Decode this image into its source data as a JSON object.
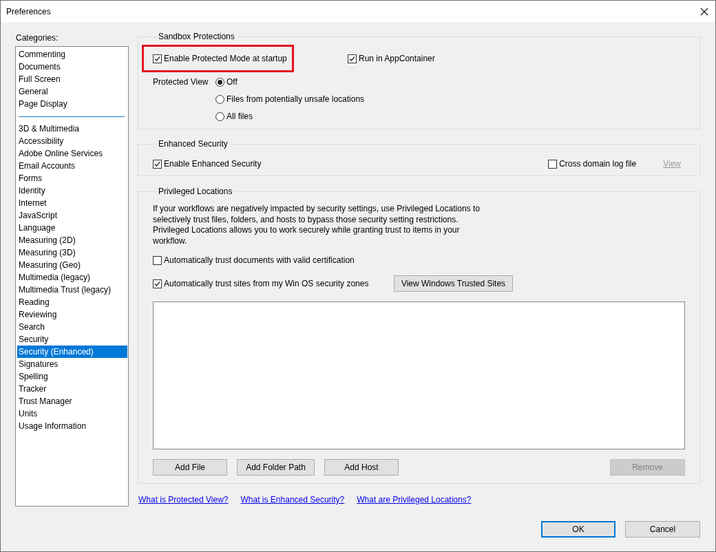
{
  "window": {
    "title": "Preferences"
  },
  "sidebar": {
    "label": "Categories:",
    "groups": [
      [
        {
          "label": "Commenting",
          "selected": false
        },
        {
          "label": "Documents",
          "selected": false
        },
        {
          "label": "Full Screen",
          "selected": false
        },
        {
          "label": "General",
          "selected": false
        },
        {
          "label": "Page Display",
          "selected": false
        }
      ],
      [
        {
          "label": "3D & Multimedia",
          "selected": false
        },
        {
          "label": "Accessibility",
          "selected": false
        },
        {
          "label": "Adobe Online Services",
          "selected": false
        },
        {
          "label": "Email Accounts",
          "selected": false
        },
        {
          "label": "Forms",
          "selected": false
        },
        {
          "label": "Identity",
          "selected": false
        },
        {
          "label": "Internet",
          "selected": false
        },
        {
          "label": "JavaScript",
          "selected": false
        },
        {
          "label": "Language",
          "selected": false
        },
        {
          "label": "Measuring (2D)",
          "selected": false
        },
        {
          "label": "Measuring (3D)",
          "selected": false
        },
        {
          "label": "Measuring (Geo)",
          "selected": false
        },
        {
          "label": "Multimedia (legacy)",
          "selected": false
        },
        {
          "label": "Multimedia Trust (legacy)",
          "selected": false
        },
        {
          "label": "Reading",
          "selected": false
        },
        {
          "label": "Reviewing",
          "selected": false
        },
        {
          "label": "Search",
          "selected": false
        },
        {
          "label": "Security",
          "selected": false
        },
        {
          "label": "Security (Enhanced)",
          "selected": true
        },
        {
          "label": "Signatures",
          "selected": false
        },
        {
          "label": "Spelling",
          "selected": false
        },
        {
          "label": "Tracker",
          "selected": false
        },
        {
          "label": "Trust Manager",
          "selected": false
        },
        {
          "label": "Units",
          "selected": false
        },
        {
          "label": "Usage Information",
          "selected": false
        }
      ]
    ]
  },
  "sandbox": {
    "title": "Sandbox Protections",
    "checkboxes": [
      {
        "label": "Enable Protected Mode at startup",
        "checked": true,
        "highlighted": true
      },
      {
        "label": "Run in AppContainer",
        "checked": true,
        "highlighted": false
      }
    ],
    "protected_view": {
      "label": "Protected View",
      "options": [
        {
          "label": "Off",
          "selected": true
        },
        {
          "label": "Files from potentially unsafe locations",
          "selected": false
        },
        {
          "label": "All files",
          "selected": false
        }
      ]
    }
  },
  "enhanced": {
    "title": "Enhanced Security",
    "checkboxes": [
      {
        "label": "Enable Enhanced Security",
        "checked": true
      },
      {
        "label": "Cross domain log file",
        "checked": false
      }
    ],
    "view_link": {
      "label": "View",
      "disabled": true
    }
  },
  "privileged": {
    "title": "Privileged Locations",
    "description": "If your workflows are negatively impacted by security settings, use Privileged Locations to\nselectively trust files, folders, and hosts to bypass those security setting restrictions.\nPrivileged Locations allows you to work securely while granting trust to items in your\nworkflow.",
    "checkboxes": [
      {
        "label": "Automatically trust documents with valid certification",
        "checked": false
      },
      {
        "label": "Automatically trust sites from my Win OS security zones",
        "checked": true
      }
    ],
    "trusted_sites_button": {
      "label": "View Windows Trusted Sites",
      "disabled": false
    },
    "buttons": [
      {
        "label": "Add File",
        "disabled": false
      },
      {
        "label": "Add Folder Path",
        "disabled": false
      },
      {
        "label": "Add Host",
        "disabled": false
      },
      {
        "label": "Remove",
        "disabled": true
      }
    ]
  },
  "links": [
    {
      "label": "What is Protected View?"
    },
    {
      "label": "What is Enhanced Security?"
    },
    {
      "label": "What are Privileged Locations?"
    }
  ],
  "buttons": [
    {
      "label": "OK",
      "default": true
    },
    {
      "label": "Cancel",
      "default": false
    }
  ]
}
